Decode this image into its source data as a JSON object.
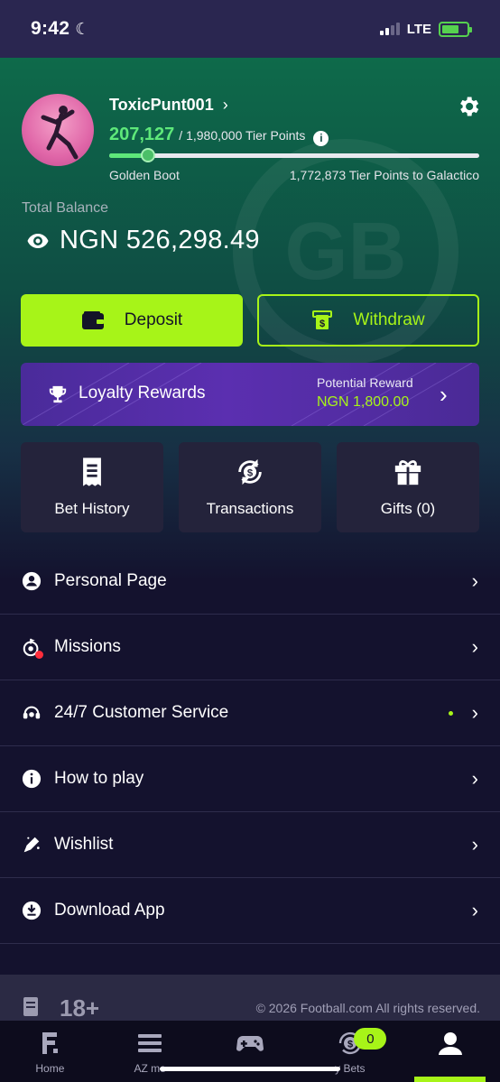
{
  "status": {
    "time": "9:42",
    "network": "LTE"
  },
  "profile": {
    "username": "ToxicPunt001",
    "tier_points": "207,127",
    "tier_points_total": "/ 1,980,000 Tier Points",
    "progress_fraction": 0.105,
    "current_tier": "Golden Boot",
    "next_tier_text": "1,772,873 Tier Points to Galactico"
  },
  "balance": {
    "label": "Total Balance",
    "value": "NGN 526,298.49"
  },
  "actions": {
    "deposit": "Deposit",
    "withdraw": "Withdraw"
  },
  "loyalty": {
    "title": "Loyalty Rewards",
    "reward_label": "Potential Reward",
    "reward_value": "NGN 1,800.00"
  },
  "tiles": [
    {
      "label": "Bet History",
      "icon": "receipt-icon"
    },
    {
      "label": "Transactions",
      "icon": "transactions-icon"
    },
    {
      "label": "Gifts (0)",
      "icon": "gift-icon"
    }
  ],
  "menu": [
    {
      "label": "Personal Page",
      "icon": "person-icon"
    },
    {
      "label": "Missions",
      "icon": "missions-icon"
    },
    {
      "label": "24/7 Customer Service",
      "icon": "headset-icon"
    },
    {
      "label": "How to play",
      "icon": "info-icon"
    },
    {
      "label": "Wishlist",
      "icon": "wishlist-icon"
    },
    {
      "label": "Download App",
      "icon": "download-icon"
    }
  ],
  "footer": {
    "age": "18+",
    "copyright": "© 2026 Football.com  All rights reserved."
  },
  "tabbar": [
    {
      "label": "Home",
      "icon": "home-icon"
    },
    {
      "label": "AZ me",
      "icon": "menu-icon"
    },
    {
      "label": "",
      "icon": "gamepad-icon"
    },
    {
      "label": "y Bets",
      "icon": "bets-icon",
      "badge": "0"
    },
    {
      "label": "",
      "icon": "profile-icon"
    }
  ],
  "colors": {
    "accent": "#a7f418",
    "points": "#5ee87a",
    "panel": "#24233b",
    "background": "#14122e"
  }
}
